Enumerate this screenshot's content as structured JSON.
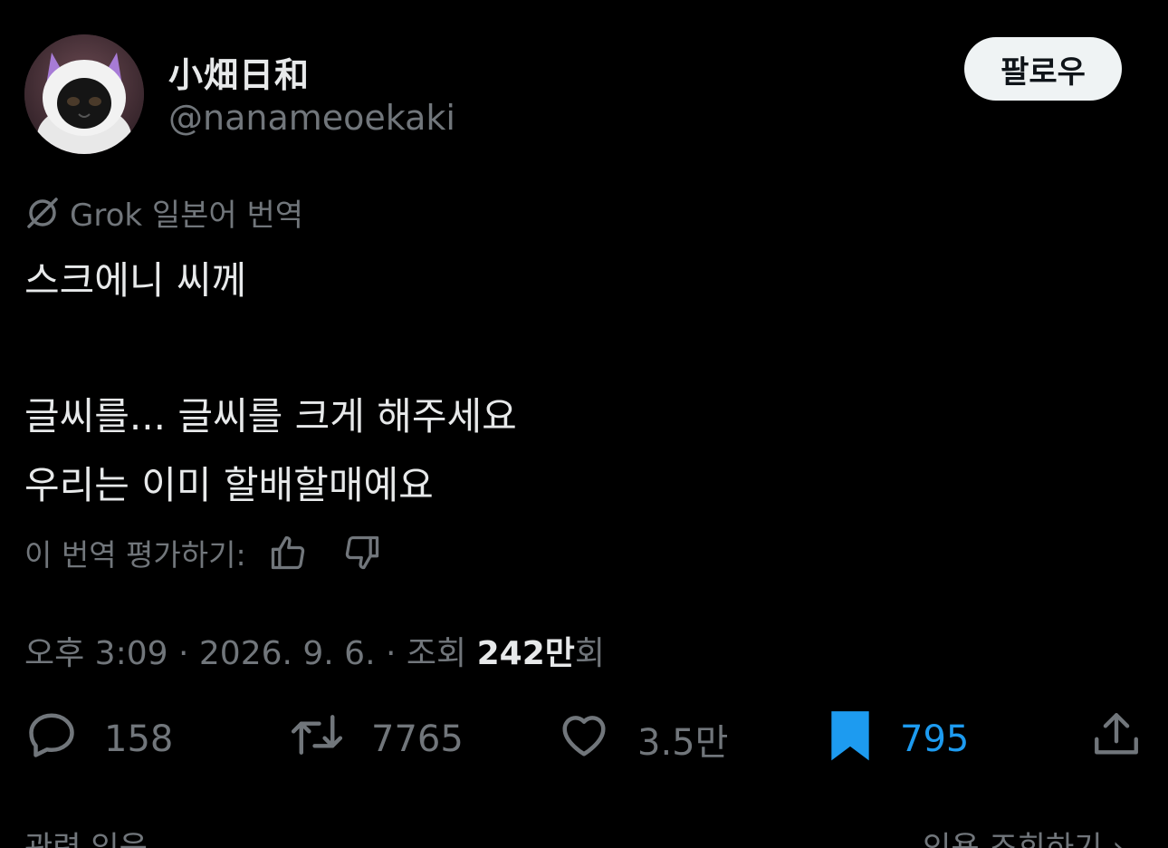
{
  "author": {
    "display_name": "小畑日和",
    "handle": "@nanameoekaki",
    "avatar_icon": "cat-avatar"
  },
  "header": {
    "follow_label": "팔로우"
  },
  "translation": {
    "label": "Grok 일본어 번역",
    "icon": "grok-icon"
  },
  "tweet": {
    "line1": "스크에니 씨께",
    "line2": "글씨를... 글씨를 크게 해주세요",
    "line3": "우리는 이미 할배할매예요"
  },
  "rate": {
    "label": "이 번역 평가하기:",
    "like_icon": "thumbs-up-icon",
    "dislike_icon": "thumbs-down-icon"
  },
  "meta": {
    "time": "오후 3:09",
    "date": "2026. 9. 6.",
    "views_label_prefix": "조회",
    "views_count": "242만",
    "views_label_suffix": "회",
    "separator": "·"
  },
  "actions": {
    "reply_count": "158",
    "retweet_count": "7765",
    "like_count": "3.5만",
    "bookmark_count": "795"
  },
  "bottom": {
    "left_label": "관련 있음 ⌄",
    "right_label": "인용 조회하기 ›"
  },
  "colors": {
    "background": "#000000",
    "text": "#e7e9ea",
    "secondary": "#71767b",
    "accent": "#1d9bf0",
    "follow_bg": "#eff3f4"
  }
}
